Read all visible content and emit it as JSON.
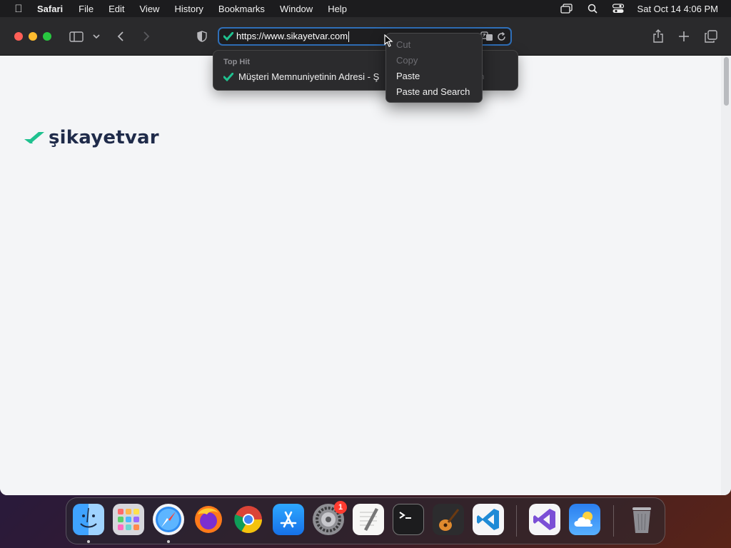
{
  "menubar": {
    "app_name": "Safari",
    "items": [
      "File",
      "Edit",
      "View",
      "History",
      "Bookmarks",
      "Window",
      "Help"
    ],
    "clock": "Sat Oct 14  4:06 PM"
  },
  "address_bar": {
    "url": "https://www.sikayetvar.com"
  },
  "suggestions": {
    "section_label": "Top Hit",
    "top_hit_title": "Müşteri Memnuniyetinin Adresi - Ş",
    "top_hit_suffix": "om"
  },
  "context_menu": {
    "items": [
      {
        "label": "Cut",
        "enabled": false
      },
      {
        "label": "Copy",
        "enabled": false
      },
      {
        "label": "Paste",
        "enabled": true
      },
      {
        "label": "Paste and Search",
        "enabled": true
      }
    ]
  },
  "page": {
    "logo_text": "şikayetvar"
  },
  "dock": {
    "apps": [
      "finder",
      "launchpad",
      "safari",
      "firefox",
      "chrome",
      "app-store",
      "system-settings",
      "textedit",
      "terminal",
      "garageband",
      "vscode",
      "visual-studio",
      "weather",
      "trash"
    ],
    "badge_count": "1"
  },
  "colors": {
    "logo_accent": "#1fc18f",
    "logo_text": "#1f2b4a",
    "address_focus": "#2f6fb8"
  }
}
